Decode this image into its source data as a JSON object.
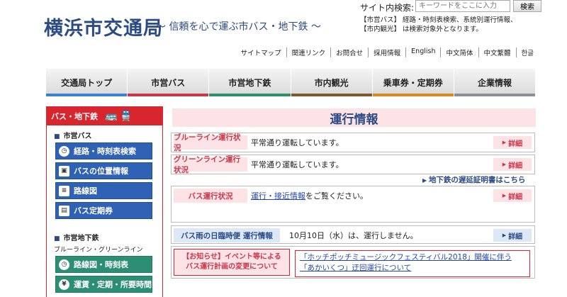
{
  "header": {
    "logo": "横浜市交通局",
    "tagline": "〜 信頼を心で運ぶ市バス・地下鉄 〜",
    "search_label": "サイト内検索:",
    "search_placeholder": "キーワードをここに入力",
    "search_button": "検索",
    "search_note_1": "【市営バス】 経路・時刻表検索、系統別運行情報、",
    "search_note_2": "【市内観光】 は検索対象外となります。"
  },
  "util_links": [
    "サイトマップ",
    "関連リンク",
    "お問合せ",
    "採用情報",
    "English",
    "中文简体",
    "中文繁體",
    "한글"
  ],
  "nav": {
    "items": [
      {
        "label": "交通局トップ",
        "color": "#3f7fd1"
      },
      {
        "label": "市営バス",
        "color": "#c8384c"
      },
      {
        "label": "市営地下鉄",
        "color": "#2f8f6c"
      },
      {
        "label": "市内観光",
        "color": "#7d5a2a"
      },
      {
        "label": "乗車券・定期券",
        "color": "#d88b1f"
      },
      {
        "label": "企業情報",
        "color": "#8a8f96"
      }
    ]
  },
  "sidebar": {
    "head": "バス・地下鉄",
    "bus_section": "市営バス",
    "bus_buttons": [
      "経路・時刻表検索",
      "バスの位置情報",
      "路線図",
      "バス定期券"
    ],
    "subway_section": "市営地下鉄",
    "subway_sub": "ブルーライン・グリーンライン",
    "subway_buttons": [
      "路線図・時刻表",
      "運賃・定期・所要時間"
    ]
  },
  "main": {
    "title": "運行情報",
    "blue_line": {
      "label": "ブルーライン運行状況",
      "text": "平常通り運転しています。",
      "detail": "詳細"
    },
    "green_line": {
      "label": "グリーンライン運行状況",
      "text": "平常通り運転しています。",
      "detail": "詳細"
    },
    "delay_cert": "地下鉄の遅延証明書はこちら",
    "bus": {
      "label": "バス運行状況",
      "link": "運行・接近情報",
      "text": "をご覧ください。",
      "detail": "詳細"
    },
    "rain": {
      "label": "バス雨の日臨時便 運行情報",
      "text": "10月10日（水）は、運行しません。",
      "detail": "詳細"
    },
    "notice": {
      "label_1": "【お知らせ】イベント等による",
      "label_2": "バス運行計画の変更について",
      "link": "「ホッチポッチミュージックフェスティバル2018」開催に伴う「あかいくつ」迂回運行について"
    }
  }
}
